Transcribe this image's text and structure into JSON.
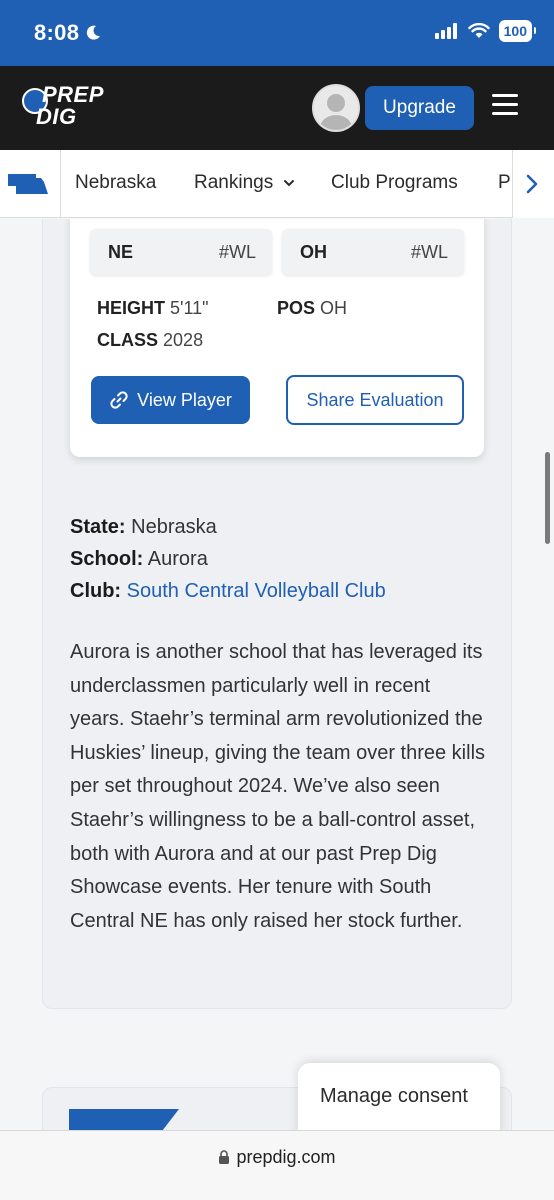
{
  "status_bar": {
    "time": "8:08",
    "battery": "100"
  },
  "header": {
    "logo_line1": "PREP",
    "logo_line2": "DIG",
    "upgrade_label": "Upgrade"
  },
  "nav": {
    "items": [
      "Nebraska",
      "Rankings",
      "Club Programs",
      "P"
    ]
  },
  "player_card": {
    "tags": [
      {
        "code": "NE",
        "rank": "#WL"
      },
      {
        "code": "OH",
        "rank": "#WL"
      }
    ],
    "height_label": "HEIGHT",
    "height_value": "5'11\"",
    "pos_label": "POS",
    "pos_value": "OH",
    "class_label": "CLASS",
    "class_value": "2028",
    "view_label": "View Player",
    "share_label": "Share Evaluation"
  },
  "details": {
    "state_label": "State:",
    "state_value": "Nebraska",
    "school_label": "School:",
    "school_value": "Aurora",
    "club_label": "Club:",
    "club_value": "South Central Volleyball Club"
  },
  "paragraph": "Aurora is another school that has leveraged its underclassmen particularly well in recent years. Staehr’s terminal arm revolutionized the Huskies’ lineup, giving the team over three kills per set throughout 2024. We’ve also seen Staehr’s willingness to be a ball-control asset, both with Aurora and at our past Prep Dig Showcase events. Her tenure with South Central NE has only raised her stock further.",
  "consent_label": "Manage consent",
  "url": "prepdig.com",
  "colors": {
    "brand_blue": "#1f5fb4",
    "header_black": "#1b1b1b",
    "card_bg": "#eef0f4"
  },
  "icons": [
    "moon-icon",
    "cellular-icon",
    "wifi-icon",
    "battery-icon",
    "user-avatar-icon",
    "hamburger-menu-icon",
    "nebraska-state-icon",
    "chevron-down-icon",
    "chevron-right-icon",
    "link-icon",
    "lock-icon"
  ]
}
